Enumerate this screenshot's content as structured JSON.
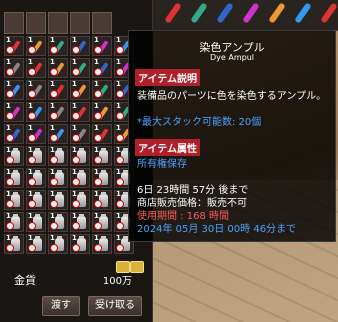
{
  "inventory": {
    "money_label": "金貨",
    "money_value": "100万",
    "buttons": {
      "give": "渡す",
      "receive": "受け取る"
    },
    "stack_count": "1"
  },
  "tooltip": {
    "item_name": "染色アンプル",
    "item_name_en": "Dye Ampul",
    "section_desc": "アイテム説明",
    "desc_text": "装備品のパーツに色を染色するアンプル。",
    "stack_text": "*最大スタック可能数: 20個",
    "section_attr": "アイテム属性",
    "attr_text": "所有権保存",
    "time_left": "6日 23時間 57分 後まで",
    "shop_text": "商店販売価格：販売不可",
    "period_text": "使用期間 : 168 時間",
    "expiry_text": "2024年 05月 30日 00時 46分まで"
  },
  "colors": {
    "header_red": "#b0202a",
    "blue_text": "#4aa3ff",
    "red_text": "#ff5a5a"
  }
}
